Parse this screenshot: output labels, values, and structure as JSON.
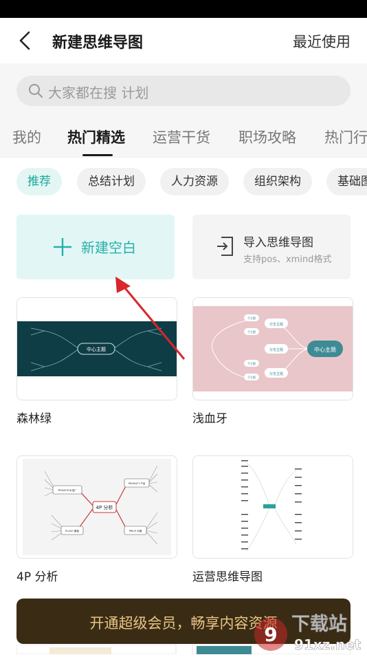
{
  "header": {
    "title": "新建思维导图",
    "recent": "最近使用"
  },
  "search": {
    "placeholder": "大家都在搜 计划"
  },
  "tabs": [
    {
      "label": "我的"
    },
    {
      "label": "热门精选"
    },
    {
      "label": "运营干货"
    },
    {
      "label": "职场攻略"
    },
    {
      "label": "热门行"
    }
  ],
  "chips": [
    {
      "label": "推荐"
    },
    {
      "label": "总结计划"
    },
    {
      "label": "人力资源"
    },
    {
      "label": "组织架构"
    },
    {
      "label": "基础图"
    }
  ],
  "actions": {
    "new_blank": "新建空白",
    "import_title": "导入思维导图",
    "import_sub": "支持pos、xmind格式"
  },
  "templates": [
    {
      "name": "森林绿",
      "center": "中心主题"
    },
    {
      "name": "浅血牙",
      "center": "中心主题",
      "branch": "分支主题",
      "sub": "子主题"
    },
    {
      "name": "4P 分析",
      "center": "4P 分析",
      "nodes": [
        "PROMOTION 推广",
        "PRODUCT 产品",
        "PLACE 渠道",
        "PRICE 价格"
      ]
    },
    {
      "name": "运营思维导图"
    }
  ],
  "vip_banner": "开通超级会员，畅享内容资源",
  "watermark": {
    "brand": "下载站",
    "url": "91xz.net"
  },
  "colors": {
    "accent": "#27b0a6",
    "forest": "#0f3d46",
    "pink": "#e9c6c9",
    "vip_bg": "#3a2c14",
    "vip_text": "#e9c486",
    "arrow": "#d8262b"
  }
}
